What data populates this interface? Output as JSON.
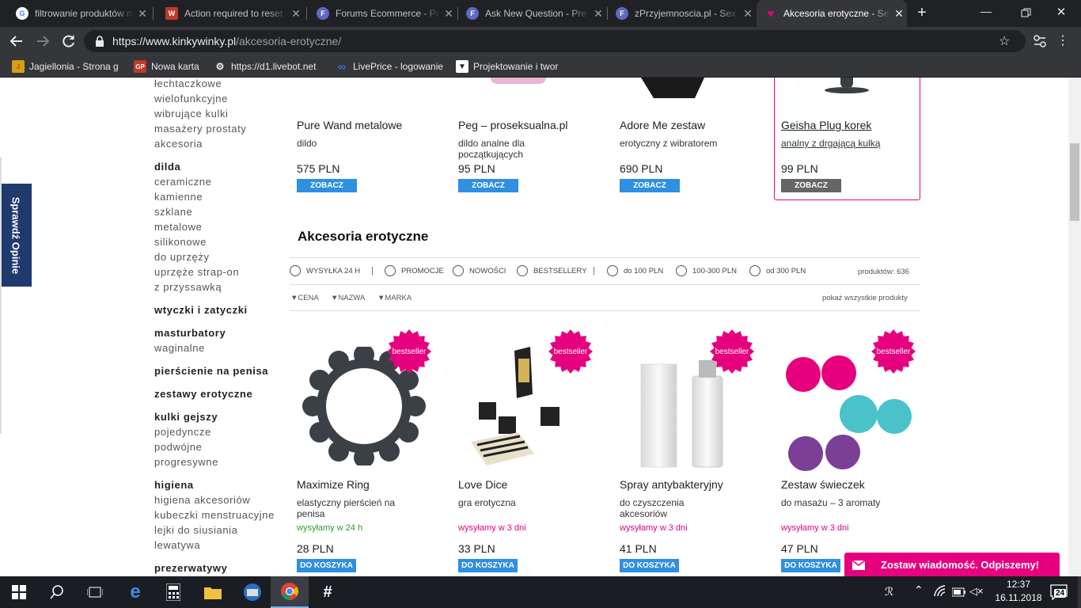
{
  "tabs": [
    {
      "title": "filtrowanie produktów n",
      "icon": "google-icon",
      "color": "#4285f4",
      "glyph": "G"
    },
    {
      "title": "Action required to reset",
      "icon": "wp-icon",
      "color": "#c0392b",
      "glyph": "W"
    },
    {
      "title": "Forums Ecommerce - Pr",
      "icon": "forum-icon",
      "color": "#5c6bc0",
      "glyph": "F"
    },
    {
      "title": "Ask New Question - Pre",
      "icon": "forum-icon",
      "color": "#5c6bc0",
      "glyph": "F"
    },
    {
      "title": "zPrzyjemnoscia.pl - Sex",
      "icon": "forum-icon",
      "color": "#5c6bc0",
      "glyph": "F"
    },
    {
      "title": "Akcesoria erotyczne - Se",
      "icon": "heart-icon",
      "color": "#e6007e",
      "glyph": "♥"
    }
  ],
  "url": {
    "host": "https://www.kinkywinky.pl",
    "path": "/akcesoria-erotyczne/"
  },
  "bookmarks": [
    {
      "label": "Jagiellonia - Strona g",
      "color": "#d4a017",
      "glyph": "J"
    },
    {
      "label": "Nowa karta",
      "color": "#c0392b",
      "glyph": "GP"
    },
    {
      "label": "https://d1.livebot.net",
      "color": "#444",
      "glyph": "⚙"
    },
    {
      "label": "LivePrice - logowanie",
      "color": "#3a6fd8",
      "glyph": "∞"
    },
    {
      "label": "Projektowanie i twor",
      "color": "#444",
      "glyph": "▼"
    }
  ],
  "sidebar": [
    {
      "label": "łechtaczkowe",
      "heading": false
    },
    {
      "label": "wielofunkcyjne",
      "heading": false
    },
    {
      "label": "wibrujące kulki",
      "heading": false
    },
    {
      "label": "masażery prostaty",
      "heading": false
    },
    {
      "label": "akcesoria",
      "heading": false
    },
    {
      "label": "dildа",
      "heading": true
    },
    {
      "label": "ceramiczne",
      "heading": false
    },
    {
      "label": "kamienne",
      "heading": false
    },
    {
      "label": "szklane",
      "heading": false
    },
    {
      "label": "metalowe",
      "heading": false
    },
    {
      "label": "silikonowe",
      "heading": false
    },
    {
      "label": "do uprzęży",
      "heading": false
    },
    {
      "label": "uprzęże strap-on",
      "heading": false
    },
    {
      "label": "z przyssawką",
      "heading": false
    },
    {
      "label": "wtyczki i zatyczki",
      "heading": true
    },
    {
      "label": "masturbatory",
      "heading": true
    },
    {
      "label": "waginalne",
      "heading": false
    },
    {
      "label": "pierścienie na penisa",
      "heading": true
    },
    {
      "label": "zestawy erotyczne",
      "heading": true
    },
    {
      "label": "kulki gejszy",
      "heading": true
    },
    {
      "label": "pojedyncze",
      "heading": false
    },
    {
      "label": "podwójne",
      "heading": false
    },
    {
      "label": "progresywne",
      "heading": false
    },
    {
      "label": "higiena",
      "heading": true
    },
    {
      "label": "higiena akcesoriów",
      "heading": false
    },
    {
      "label": "kubeczki menstruacyjne",
      "heading": false
    },
    {
      "label": "lejki do siusiania",
      "heading": false
    },
    {
      "label": "lewatywa",
      "heading": false
    },
    {
      "label": "prezerwatywy",
      "heading": true
    }
  ],
  "side_tab": "Sprawdź Opinie",
  "top_products": [
    {
      "name": "Pure Wand metalowe",
      "desc": "dildo",
      "price": "575 PLN",
      "button": "ZOBACZ",
      "hovered": false
    },
    {
      "name": "Peg – proseksualna.pl",
      "desc": "dildo analne dla początkujących",
      "price": "95 PLN",
      "button": "ZOBACZ",
      "hovered": false
    },
    {
      "name": "Adore Me zestaw",
      "desc": "erotyczny z wibratorem",
      "price": "690 PLN",
      "button": "ZOBACZ",
      "hovered": false
    },
    {
      "name": "Geisha Plug korek",
      "desc": "analny z drgającą kulką",
      "price": "99 PLN",
      "button": "ZOBACZ",
      "hovered": true
    }
  ],
  "section_title": "Akcesoria erotyczne",
  "filters": [
    {
      "label": "WYSYŁKA 24 H"
    },
    {
      "label": "PROMOCJE"
    },
    {
      "label": "NOWOŚCI"
    },
    {
      "label": "BESTSELLERY"
    },
    {
      "label": "do 100 PLN"
    },
    {
      "label": "100-300 PLN"
    },
    {
      "label": "od 300 PLN"
    }
  ],
  "filter_divider": "|",
  "product_count": "produktów: 636",
  "sorts": [
    "▼CENA",
    "▼NAZWA",
    "▼MARKA"
  ],
  "show_all": "pokaż wszystkie produkty",
  "products": [
    {
      "name": "Maximize Ring",
      "desc": "elastyczny pierścień na penisa",
      "ship": "wysyłamy w 24 h",
      "ship_color": "#2e9e2e",
      "price": "28 PLN",
      "button": "DO KOSZYKA",
      "badge": "bestseller"
    },
    {
      "name": "Love Dice",
      "desc": "gra erotyczna",
      "ship": "wysyłamy w 3 dni",
      "ship_color": "#e6007e",
      "price": "33 PLN",
      "button": "DO KOSZYKA",
      "badge": "bestseller"
    },
    {
      "name": "Spray antybakteryjny",
      "desc": "do czyszczenia akcesoriów",
      "ship": "wysyłamy w 3 dni",
      "ship_color": "#e6007e",
      "price": "41 PLN",
      "button": "DO KOSZYKA",
      "badge": "bestseller"
    },
    {
      "name": "Zestaw świeczek",
      "desc": "do masażu – 3 aromaty",
      "ship": "wysyłamy w 3 dni",
      "ship_color": "#e6007e",
      "price": "47 PLN",
      "button": "DO KOSZYKA",
      "badge": "bestseller"
    }
  ],
  "chat_widget": "Zostaw wiadomość. Odpiszemy!",
  "colors": {
    "accent": "#e6007e",
    "button": "#2f8fe0",
    "button_hover": "#666666"
  },
  "taskbar": {
    "time": "12:37",
    "date": "16.11.2018",
    "notifications": "24"
  }
}
